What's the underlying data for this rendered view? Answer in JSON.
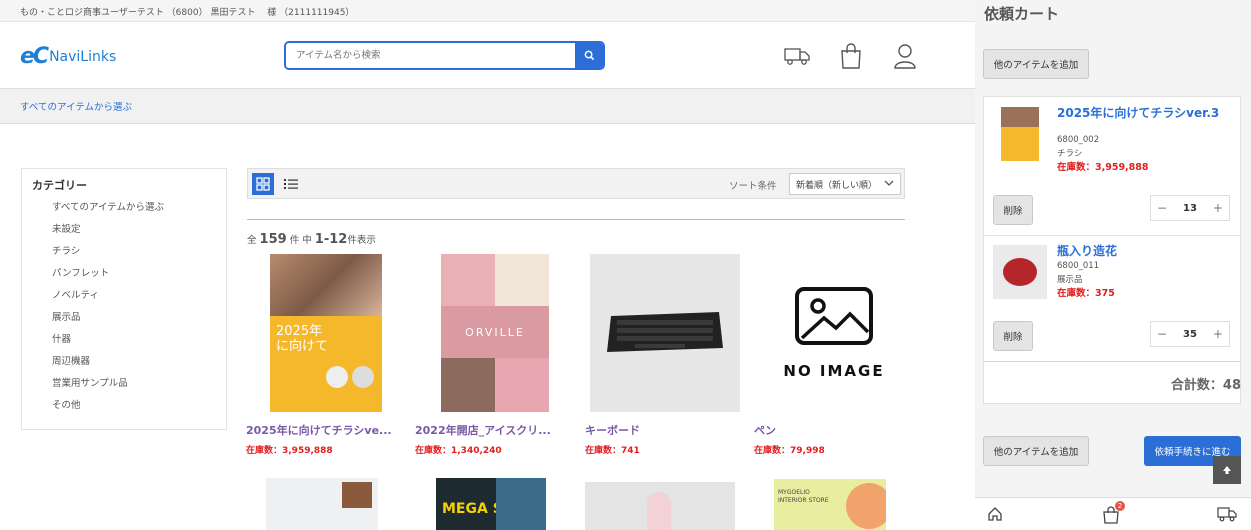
{
  "user_bar": {
    "text": "もの・ことロジ商事ユーザーテスト （6800） 黒田テスト　 様 （2111111945）"
  },
  "header": {
    "logo_mark": "eC",
    "logo_text": "NaviLinks",
    "search_placeholder": "アイテム名から検索",
    "icons": [
      "truck-icon",
      "bag-icon",
      "user-icon"
    ]
  },
  "breadcrumb": {
    "label": "すべてのアイテムから選ぶ"
  },
  "categories": {
    "title": "カテゴリー",
    "items": [
      {
        "label": "すべてのアイテムから選ぶ"
      },
      {
        "label": "未設定"
      },
      {
        "label": "チラシ"
      },
      {
        "label": "パンフレット"
      },
      {
        "label": "ノベルティ"
      },
      {
        "label": "展示品"
      },
      {
        "label": "什器"
      },
      {
        "label": "周辺機器"
      },
      {
        "label": "営業用サンプル品"
      },
      {
        "label": "その他"
      }
    ]
  },
  "toolbar": {
    "sort_label": "ソート条件",
    "sort_value": "新着順（新しい順）"
  },
  "results": {
    "prefix": "全",
    "total": "159",
    "unit_middle": "件 中",
    "range": "1-12",
    "suffix": "件表示"
  },
  "products": [
    {
      "name": "2025年に向けてチラシve...",
      "stock": "在庫数：3,959,888",
      "image_text": "2025年に向けて"
    },
    {
      "name": "2022年開店_アイスクリ...",
      "stock": "在庫数：1,340,240",
      "image_text": "ORVILLE"
    },
    {
      "name": "キーボード",
      "stock": "在庫数：741"
    },
    {
      "name": "ペン",
      "stock": "在庫数：79,998",
      "image_text": "NO IMAGE"
    }
  ],
  "bottom_row_images": [
    {
      "text": ""
    },
    {
      "text": "MEGA SALE"
    },
    {
      "text": ""
    },
    {
      "text": "MYGOELIO INTERIOR STORE"
    }
  ],
  "cart": {
    "title": "依頼カート",
    "add_button": "他のアイテムを追加",
    "items": [
      {
        "name": "2025年に向けてチラシver.3",
        "code": "6800_002",
        "category": "チラシ",
        "stock": "在庫数：3,959,888",
        "qty": "13",
        "delete": "削除"
      },
      {
        "name": "瓶入り造花",
        "code": "6800_011",
        "category": "展示品",
        "stock": "在庫数：375",
        "qty": "35",
        "delete": "削除"
      }
    ],
    "total": "合計数：48",
    "checkout_button": "依頼手続きに進む",
    "badge": "2",
    "colors": {
      "accent": "#2b6fd6",
      "stock_red": "#e02020",
      "product_name": "#7a5aa6"
    }
  }
}
